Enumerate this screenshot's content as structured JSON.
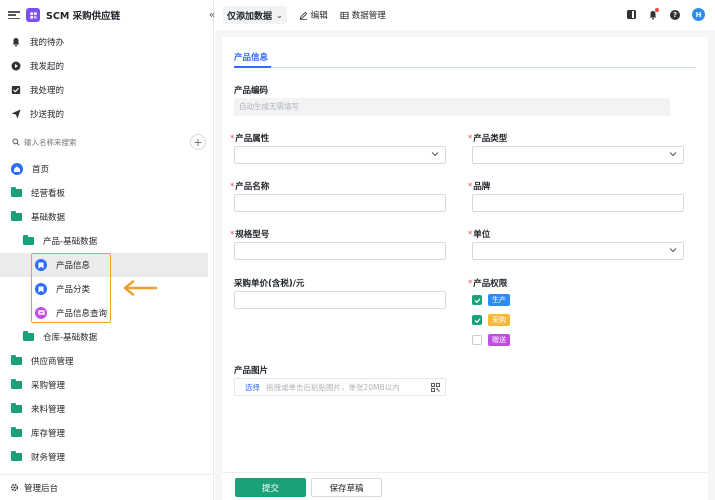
{
  "app": {
    "name": "SCM 采购供应链"
  },
  "quick": [
    {
      "label": "我的待办",
      "icon": "bell-icon"
    },
    {
      "label": "我发起的",
      "icon": "play-icon"
    },
    {
      "label": "我处理的",
      "icon": "inbox-icon"
    },
    {
      "label": "抄送我的",
      "icon": "send-icon"
    }
  ],
  "search": {
    "placeholder": "输入名称来搜索"
  },
  "nav": {
    "home": "首页",
    "dashboard": "经营看板",
    "base_data": "基础数据",
    "product_base": "产品-基础数据",
    "product_info": "产品信息",
    "product_category": "产品分类",
    "product_query": "产品信息查询",
    "warehouse_base": "仓库-基础数据",
    "supplier": "供应商管理",
    "purchase": "采购管理",
    "incoming": "来料管理",
    "inventory": "库存管理",
    "finance": "财务管理"
  },
  "footer": {
    "admin": "管理后台"
  },
  "topbar": {
    "view": "仅添加数据",
    "edit": "编辑",
    "data_manage": "数据管理",
    "avatar": "H"
  },
  "form": {
    "tab": "产品信息",
    "code_label": "产品编码",
    "code_placeholder": "自动生成无需填写",
    "attr_label": "产品属性",
    "type_label": "产品类型",
    "name_label": "产品名称",
    "brand_label": "品牌",
    "spec_label": "规格型号",
    "unit_label": "单位",
    "price_label": "采购单价(含税)/元",
    "perm_label": "产品权限",
    "perms": [
      {
        "label": "生产",
        "checked": true,
        "color": "#2d8cf0"
      },
      {
        "label": "采购",
        "checked": true,
        "color": "#f5b93a"
      },
      {
        "label": "赠送",
        "checked": false,
        "color": "#c04fe0"
      }
    ],
    "image_label": "产品图片",
    "upload_select": "选择",
    "upload_hint": "拖拽或单击后粘贴图片，单张20MB以内",
    "submit": "提交",
    "draft": "保存草稿"
  }
}
